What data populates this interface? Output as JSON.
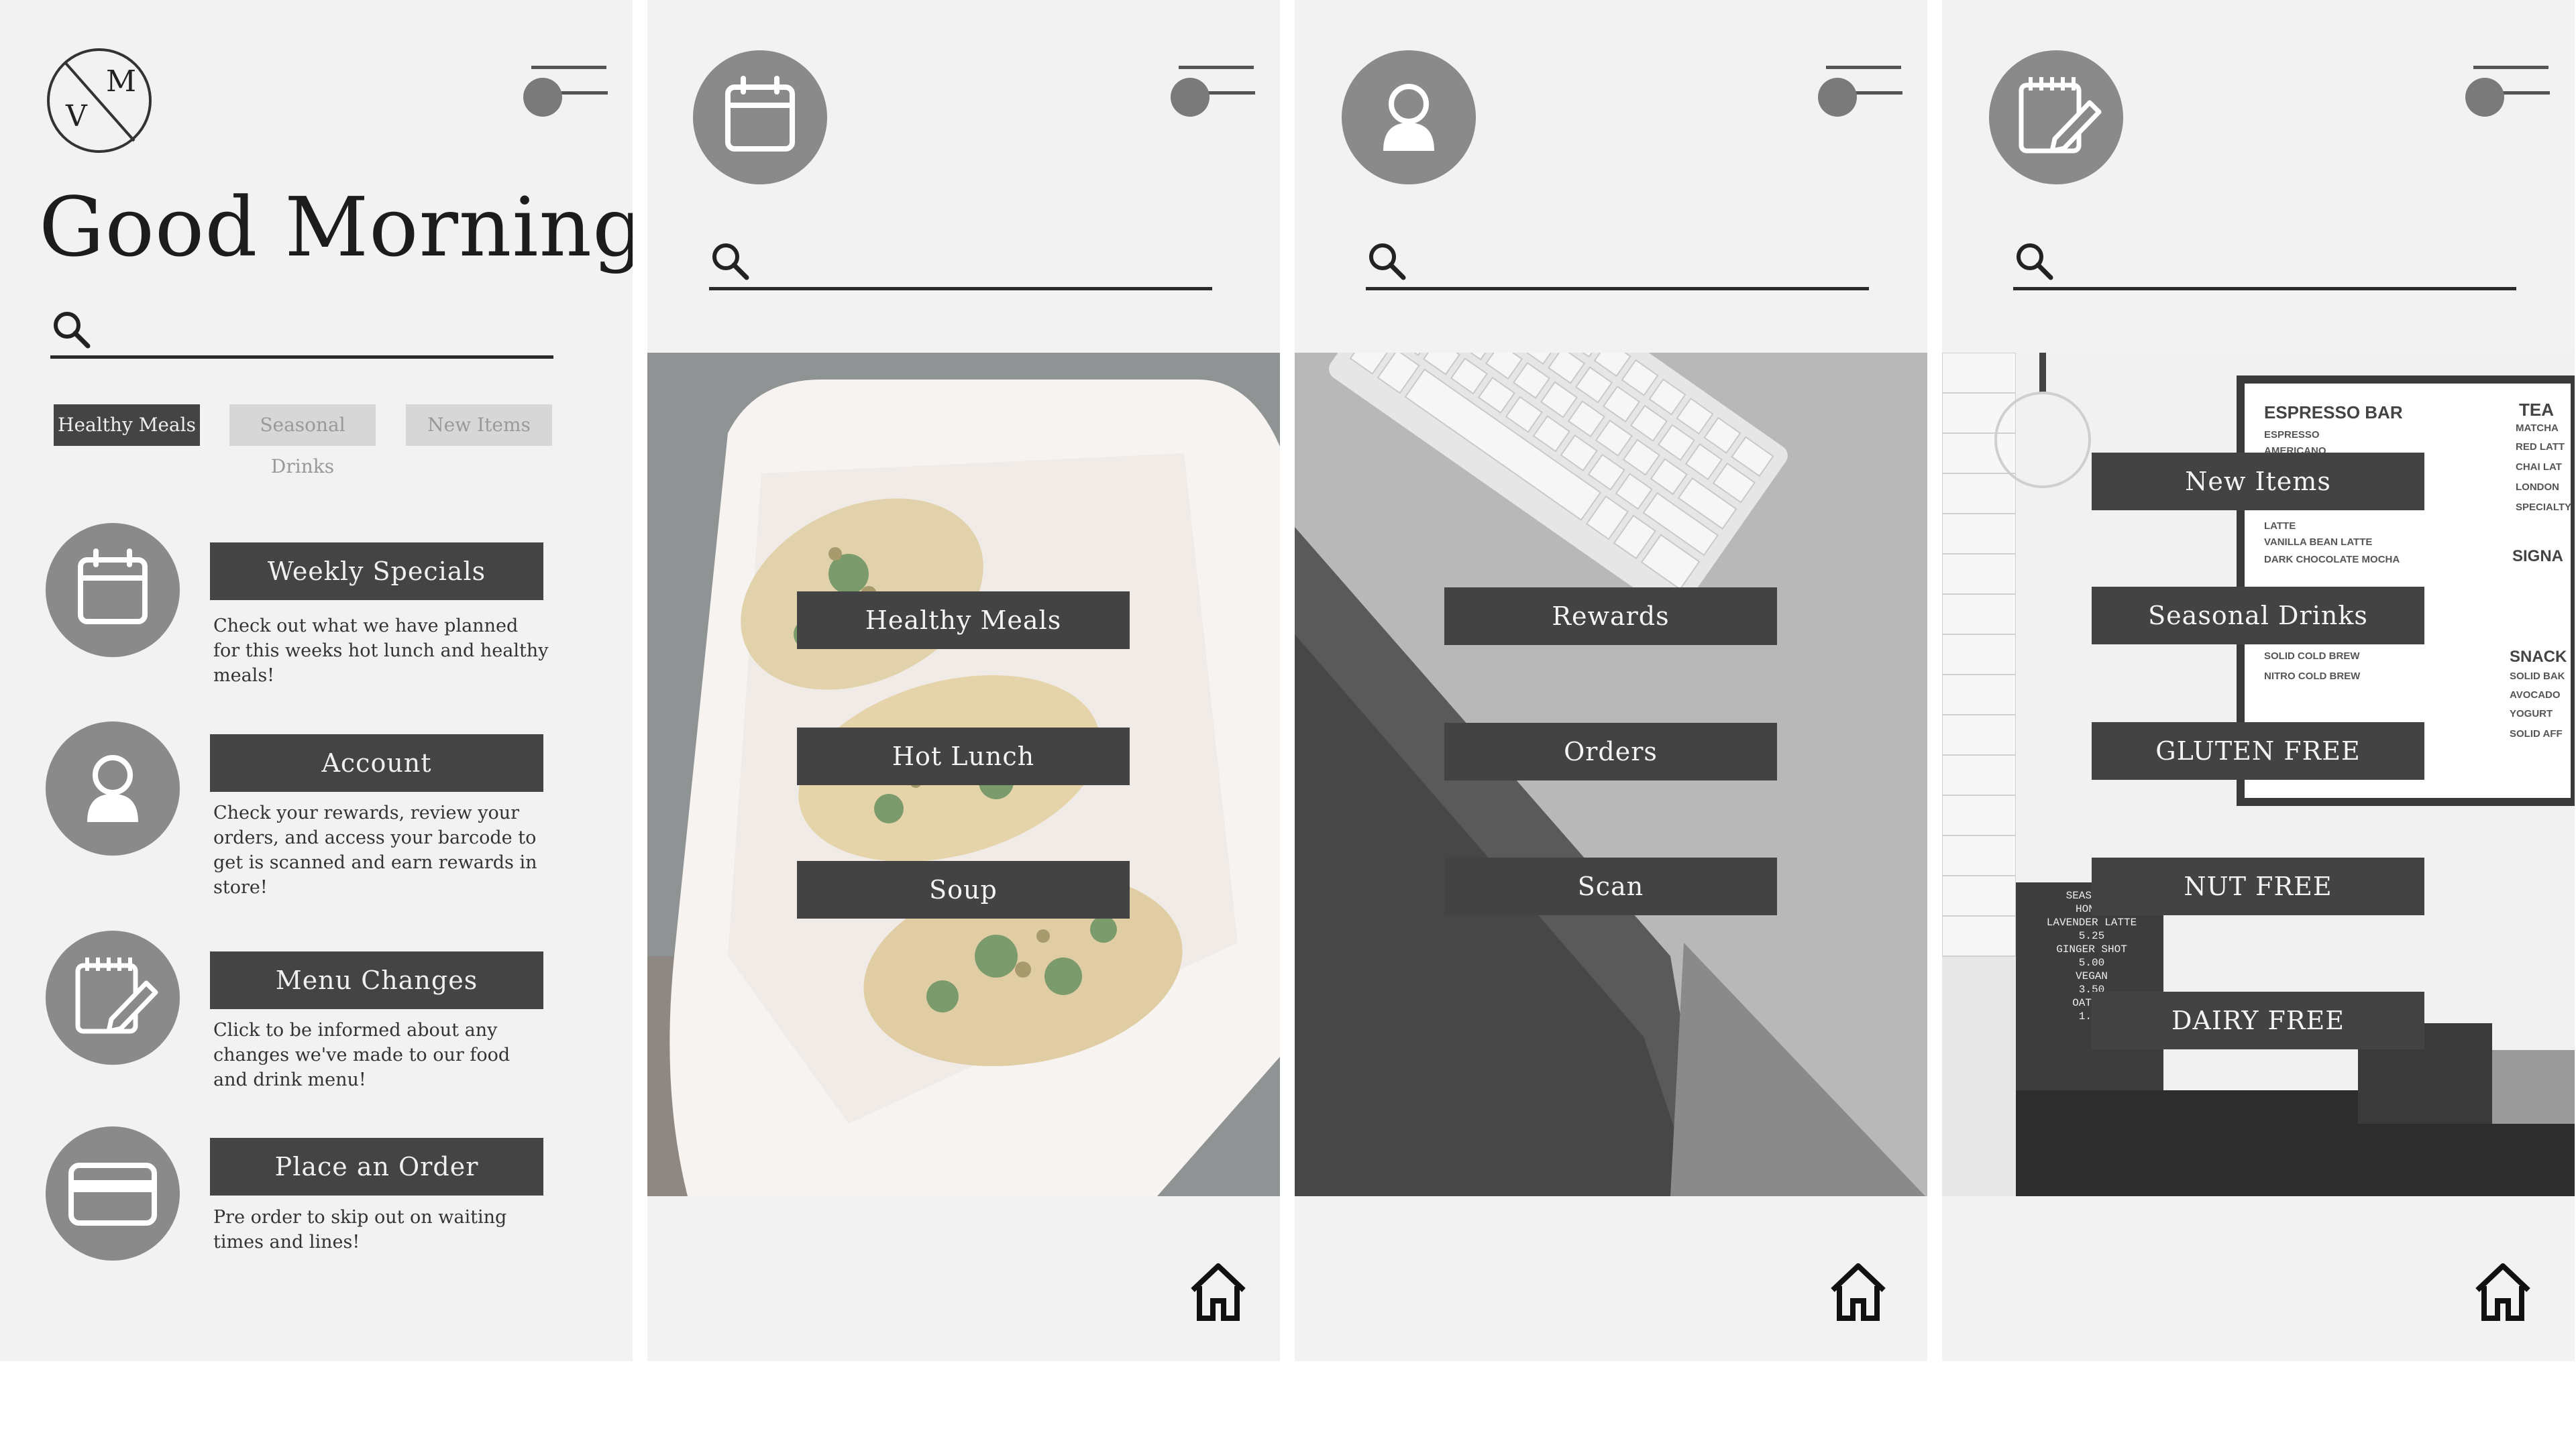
{
  "home_screen": {
    "logo_letters": "MV",
    "greeting": "Good Morning",
    "chips": [
      "Healthy Meals",
      "Seasonal Drinks",
      "New Items"
    ],
    "cards": [
      {
        "title": "Weekly Specials",
        "description": "Check out what we have planned for this weeks hot lunch and healthy meals!",
        "icon": "calendar-icon"
      },
      {
        "title": "Account",
        "description": "Check your rewards, review your orders, and access your barcode to get is scanned and earn rewards in store!",
        "icon": "user-icon"
      },
      {
        "title": "Menu Changes",
        "description": "Click to be informed about any changes we've made to our food and drink menu!",
        "icon": "notepad-edit-icon"
      },
      {
        "title": "Place an Order",
        "description": "Pre order to skip out on waiting times and lines!",
        "icon": "credit-card-icon"
      }
    ]
  },
  "meals_screen": {
    "icon": "calendar-icon",
    "buttons": [
      "Healthy Meals",
      "Hot Lunch",
      "Soup"
    ]
  },
  "account_screen": {
    "icon": "user-icon",
    "buttons": [
      "Rewards",
      "Orders",
      "Scan"
    ]
  },
  "menu_screen": {
    "icon": "notepad-edit-icon",
    "buttons": [
      "New Items",
      "Seasonal Drinks",
      "GLUTEN FREE",
      "NUT FREE",
      "DAIRY FREE"
    ],
    "board_menu": {
      "espresso_header": "ESPRESSO BAR",
      "espresso_items": [
        "ESPRESSO",
        "AMERICANO",
        "LATTE",
        "VANILLA BEAN LATTE",
        "DARK CHOCOLATE MOCHA",
        "SOLID COLD BREW",
        "NITRO COLD BREW"
      ],
      "tea_header": "TEA",
      "tea_items": [
        "MATCHA",
        "RED LATT",
        "CHAI LAT",
        "LONDON",
        "SPECIALTY"
      ],
      "signature_header": "SIGNA",
      "snack_header": "SNACK",
      "snack_items": [
        "SOLID BAK",
        "AVOCADO",
        "YOGURT",
        "SOLID AFF"
      ],
      "letterboard_lines": [
        "SEASONAL",
        "HONEY",
        "LAVENDER LATTE",
        "5.25",
        "GINGER SHOT",
        "5.00",
        "VEGAN",
        "3.50",
        "OAT MI",
        "1.00"
      ]
    }
  },
  "colors": {
    "panel_bg": "#f2f2f2",
    "button_bg": "#444444",
    "icon_circle": "#8a8a8a",
    "chip_inactive": "#d7d7d7"
  }
}
